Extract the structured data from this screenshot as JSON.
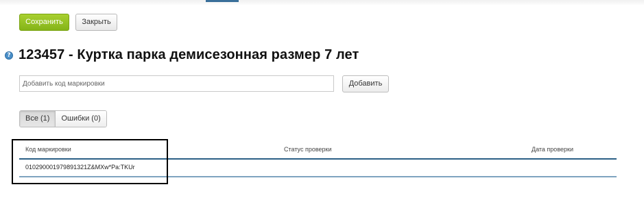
{
  "toolbar": {
    "save_label": "Сохранить",
    "close_label": "Закрыть"
  },
  "title": {
    "text": "123457 - Куртка парка демисезонная размер 7 лет",
    "help_icon": "?"
  },
  "add_code": {
    "placeholder": "Добавить код маркировки",
    "value": "",
    "button_label": "Добавить"
  },
  "tabs": [
    {
      "label": "Все (1)",
      "active": true
    },
    {
      "label": "Ошибки (0)",
      "active": false
    }
  ],
  "table": {
    "columns": [
      "Код маркировки",
      "Статус проверки",
      "Дата проверки"
    ],
    "rows": [
      [
        "010290001979891321Z&MXw*Pa:TKUr",
        "",
        ""
      ]
    ]
  },
  "colors": {
    "save_button": "#93c220",
    "table_rule": "#2b5f86",
    "help_icon": "#4a8fc8"
  }
}
